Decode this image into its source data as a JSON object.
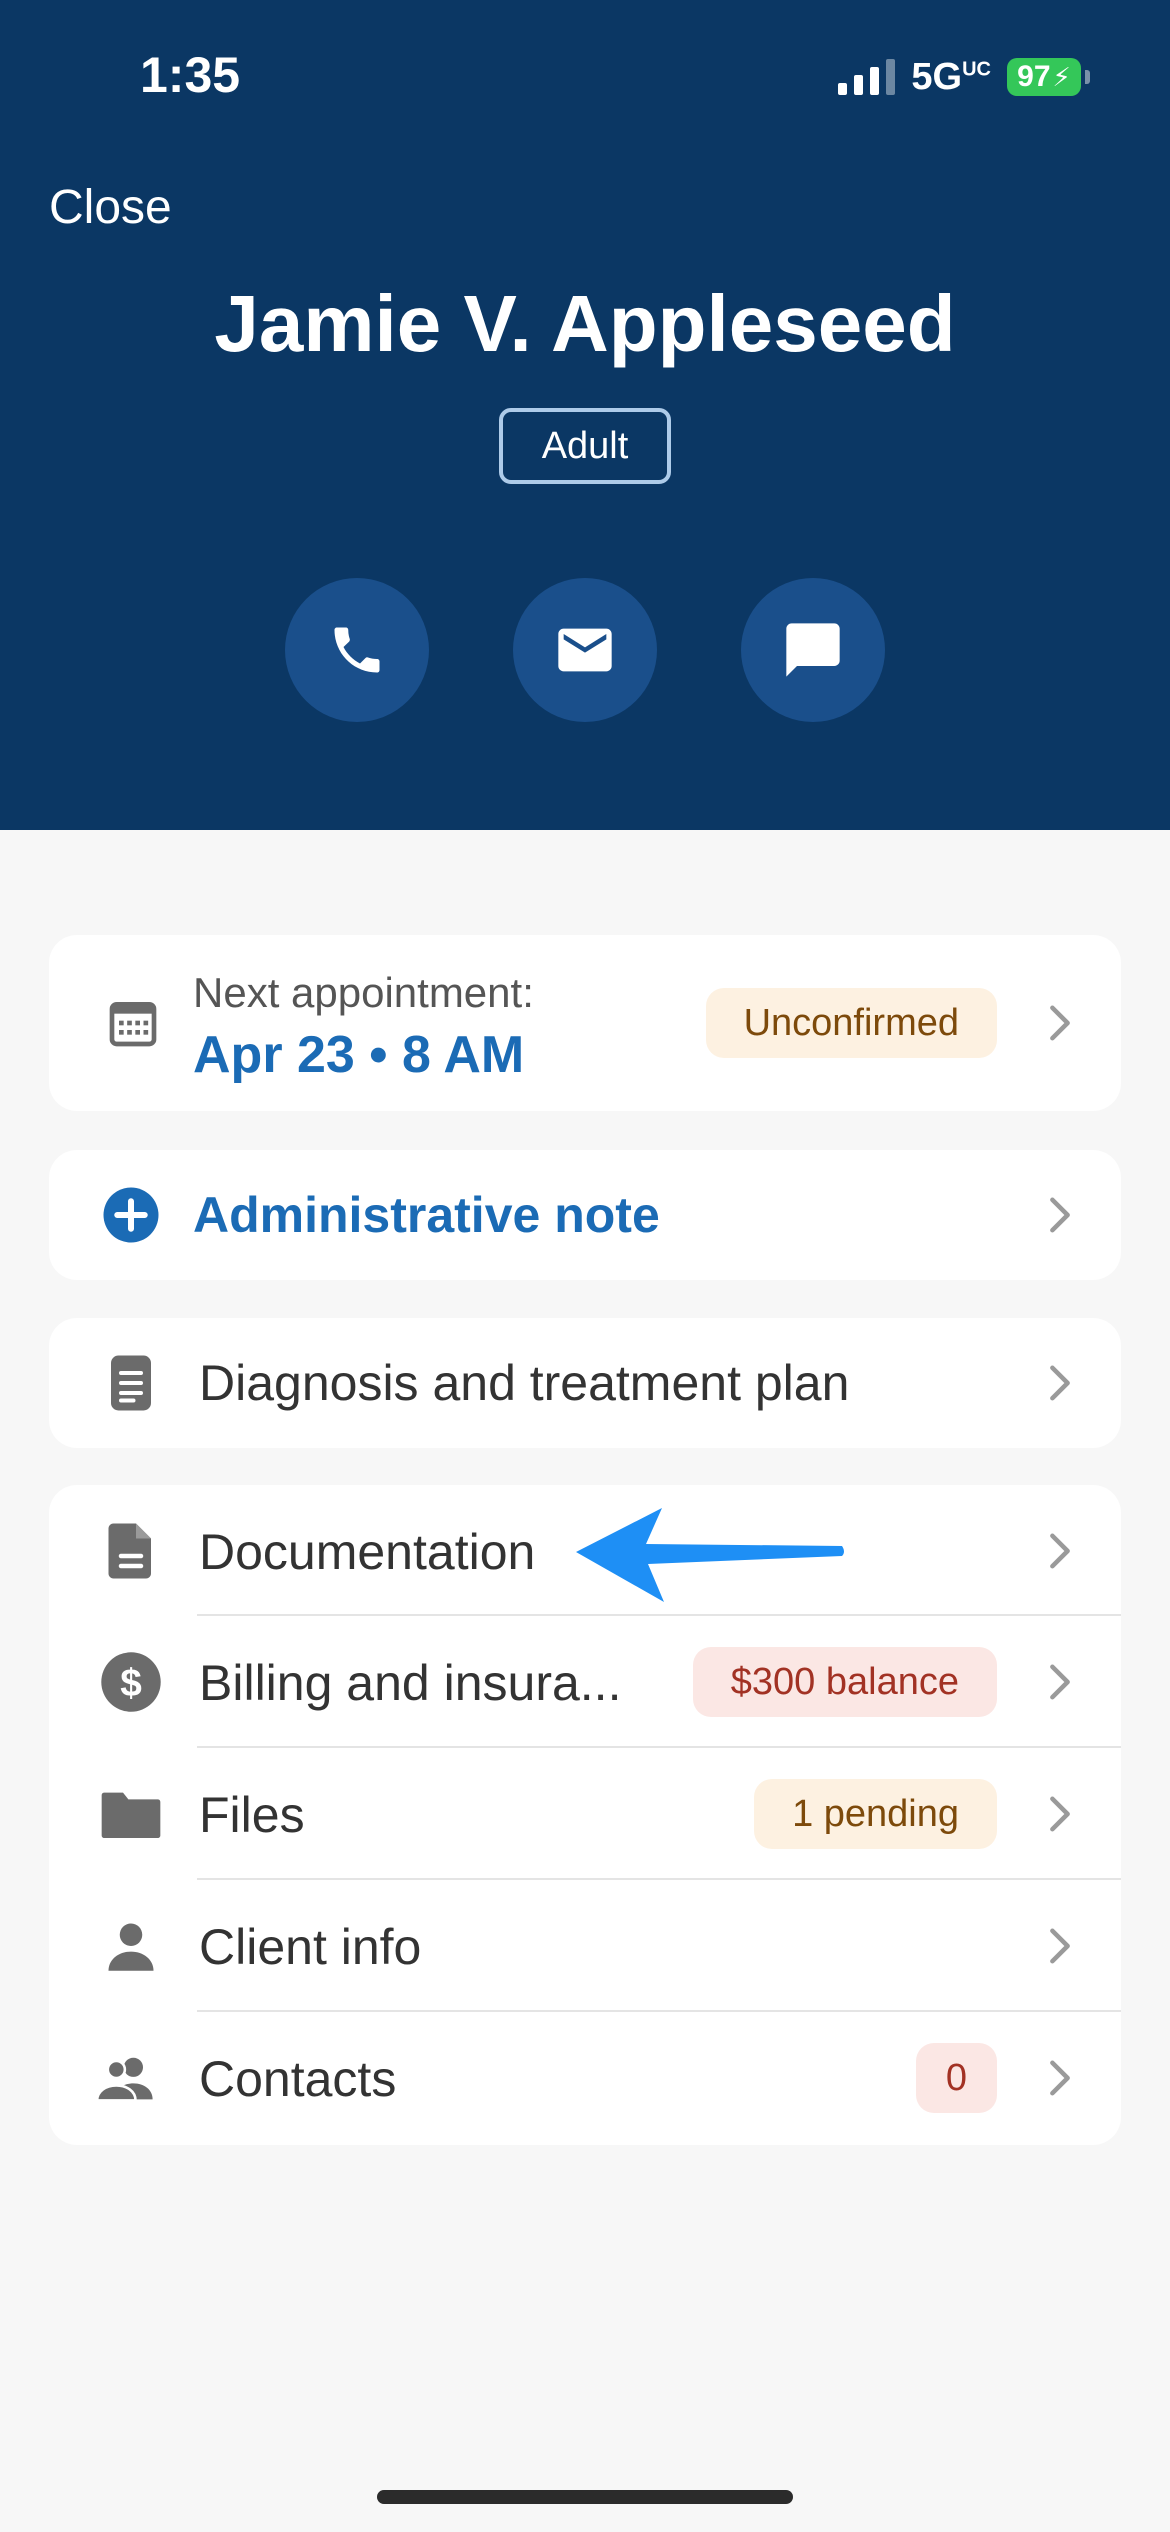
{
  "status_bar": {
    "time": "1:35",
    "network": "5G",
    "network_suffix": "UC",
    "battery": "97"
  },
  "header": {
    "close_label": "Close",
    "patient_name": "Jamie V. Appleseed",
    "age_group": "Adult",
    "actions": [
      {
        "icon": "phone-icon"
      },
      {
        "icon": "mail-icon"
      },
      {
        "icon": "chat-icon"
      }
    ]
  },
  "appointment": {
    "caption": "Next appointment:",
    "date": "Apr 23 • 8 AM",
    "status": "Unconfirmed",
    "icon": "calendar-icon"
  },
  "admin_note": {
    "label": "Administrative note",
    "icon": "plus-circle-icon"
  },
  "diagnosis": {
    "label": "Diagnosis and treatment plan",
    "icon": "clipboard-icon"
  },
  "menu": [
    {
      "label": "Documentation",
      "icon": "document-icon",
      "badge": ""
    },
    {
      "label": "Billing and insura...",
      "icon": "dollar-icon",
      "badge": "$300 balance"
    },
    {
      "label": "Files",
      "icon": "folder-icon",
      "badge": "1 pending"
    },
    {
      "label": "Client info",
      "icon": "person-icon",
      "badge": ""
    },
    {
      "label": "Contacts",
      "icon": "people-icon",
      "badge": "0"
    }
  ],
  "colors": {
    "header_bg": "#0b3764",
    "accent": "#1b6bb5",
    "arrow": "#1e8ff5"
  }
}
